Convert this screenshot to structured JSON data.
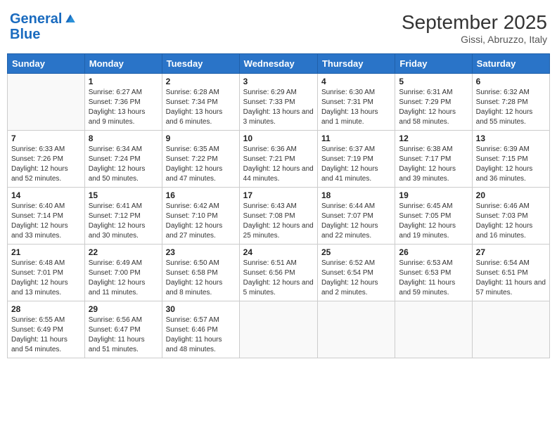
{
  "header": {
    "logo_line1": "General",
    "logo_line2": "Blue",
    "month": "September 2025",
    "location": "Gissi, Abruzzo, Italy"
  },
  "weekdays": [
    "Sunday",
    "Monday",
    "Tuesday",
    "Wednesday",
    "Thursday",
    "Friday",
    "Saturday"
  ],
  "weeks": [
    [
      {
        "day": "",
        "sunrise": "",
        "sunset": "",
        "daylight": ""
      },
      {
        "day": "1",
        "sunrise": "Sunrise: 6:27 AM",
        "sunset": "Sunset: 7:36 PM",
        "daylight": "Daylight: 13 hours and 9 minutes."
      },
      {
        "day": "2",
        "sunrise": "Sunrise: 6:28 AM",
        "sunset": "Sunset: 7:34 PM",
        "daylight": "Daylight: 13 hours and 6 minutes."
      },
      {
        "day": "3",
        "sunrise": "Sunrise: 6:29 AM",
        "sunset": "Sunset: 7:33 PM",
        "daylight": "Daylight: 13 hours and 3 minutes."
      },
      {
        "day": "4",
        "sunrise": "Sunrise: 6:30 AM",
        "sunset": "Sunset: 7:31 PM",
        "daylight": "Daylight: 13 hours and 1 minute."
      },
      {
        "day": "5",
        "sunrise": "Sunrise: 6:31 AM",
        "sunset": "Sunset: 7:29 PM",
        "daylight": "Daylight: 12 hours and 58 minutes."
      },
      {
        "day": "6",
        "sunrise": "Sunrise: 6:32 AM",
        "sunset": "Sunset: 7:28 PM",
        "daylight": "Daylight: 12 hours and 55 minutes."
      }
    ],
    [
      {
        "day": "7",
        "sunrise": "Sunrise: 6:33 AM",
        "sunset": "Sunset: 7:26 PM",
        "daylight": "Daylight: 12 hours and 52 minutes."
      },
      {
        "day": "8",
        "sunrise": "Sunrise: 6:34 AM",
        "sunset": "Sunset: 7:24 PM",
        "daylight": "Daylight: 12 hours and 50 minutes."
      },
      {
        "day": "9",
        "sunrise": "Sunrise: 6:35 AM",
        "sunset": "Sunset: 7:22 PM",
        "daylight": "Daylight: 12 hours and 47 minutes."
      },
      {
        "day": "10",
        "sunrise": "Sunrise: 6:36 AM",
        "sunset": "Sunset: 7:21 PM",
        "daylight": "Daylight: 12 hours and 44 minutes."
      },
      {
        "day": "11",
        "sunrise": "Sunrise: 6:37 AM",
        "sunset": "Sunset: 7:19 PM",
        "daylight": "Daylight: 12 hours and 41 minutes."
      },
      {
        "day": "12",
        "sunrise": "Sunrise: 6:38 AM",
        "sunset": "Sunset: 7:17 PM",
        "daylight": "Daylight: 12 hours and 39 minutes."
      },
      {
        "day": "13",
        "sunrise": "Sunrise: 6:39 AM",
        "sunset": "Sunset: 7:15 PM",
        "daylight": "Daylight: 12 hours and 36 minutes."
      }
    ],
    [
      {
        "day": "14",
        "sunrise": "Sunrise: 6:40 AM",
        "sunset": "Sunset: 7:14 PM",
        "daylight": "Daylight: 12 hours and 33 minutes."
      },
      {
        "day": "15",
        "sunrise": "Sunrise: 6:41 AM",
        "sunset": "Sunset: 7:12 PM",
        "daylight": "Daylight: 12 hours and 30 minutes."
      },
      {
        "day": "16",
        "sunrise": "Sunrise: 6:42 AM",
        "sunset": "Sunset: 7:10 PM",
        "daylight": "Daylight: 12 hours and 27 minutes."
      },
      {
        "day": "17",
        "sunrise": "Sunrise: 6:43 AM",
        "sunset": "Sunset: 7:08 PM",
        "daylight": "Daylight: 12 hours and 25 minutes."
      },
      {
        "day": "18",
        "sunrise": "Sunrise: 6:44 AM",
        "sunset": "Sunset: 7:07 PM",
        "daylight": "Daylight: 12 hours and 22 minutes."
      },
      {
        "day": "19",
        "sunrise": "Sunrise: 6:45 AM",
        "sunset": "Sunset: 7:05 PM",
        "daylight": "Daylight: 12 hours and 19 minutes."
      },
      {
        "day": "20",
        "sunrise": "Sunrise: 6:46 AM",
        "sunset": "Sunset: 7:03 PM",
        "daylight": "Daylight: 12 hours and 16 minutes."
      }
    ],
    [
      {
        "day": "21",
        "sunrise": "Sunrise: 6:48 AM",
        "sunset": "Sunset: 7:01 PM",
        "daylight": "Daylight: 12 hours and 13 minutes."
      },
      {
        "day": "22",
        "sunrise": "Sunrise: 6:49 AM",
        "sunset": "Sunset: 7:00 PM",
        "daylight": "Daylight: 12 hours and 11 minutes."
      },
      {
        "day": "23",
        "sunrise": "Sunrise: 6:50 AM",
        "sunset": "Sunset: 6:58 PM",
        "daylight": "Daylight: 12 hours and 8 minutes."
      },
      {
        "day": "24",
        "sunrise": "Sunrise: 6:51 AM",
        "sunset": "Sunset: 6:56 PM",
        "daylight": "Daylight: 12 hours and 5 minutes."
      },
      {
        "day": "25",
        "sunrise": "Sunrise: 6:52 AM",
        "sunset": "Sunset: 6:54 PM",
        "daylight": "Daylight: 12 hours and 2 minutes."
      },
      {
        "day": "26",
        "sunrise": "Sunrise: 6:53 AM",
        "sunset": "Sunset: 6:53 PM",
        "daylight": "Daylight: 11 hours and 59 minutes."
      },
      {
        "day": "27",
        "sunrise": "Sunrise: 6:54 AM",
        "sunset": "Sunset: 6:51 PM",
        "daylight": "Daylight: 11 hours and 57 minutes."
      }
    ],
    [
      {
        "day": "28",
        "sunrise": "Sunrise: 6:55 AM",
        "sunset": "Sunset: 6:49 PM",
        "daylight": "Daylight: 11 hours and 54 minutes."
      },
      {
        "day": "29",
        "sunrise": "Sunrise: 6:56 AM",
        "sunset": "Sunset: 6:47 PM",
        "daylight": "Daylight: 11 hours and 51 minutes."
      },
      {
        "day": "30",
        "sunrise": "Sunrise: 6:57 AM",
        "sunset": "Sunset: 6:46 PM",
        "daylight": "Daylight: 11 hours and 48 minutes."
      },
      {
        "day": "",
        "sunrise": "",
        "sunset": "",
        "daylight": ""
      },
      {
        "day": "",
        "sunrise": "",
        "sunset": "",
        "daylight": ""
      },
      {
        "day": "",
        "sunrise": "",
        "sunset": "",
        "daylight": ""
      },
      {
        "day": "",
        "sunrise": "",
        "sunset": "",
        "daylight": ""
      }
    ]
  ]
}
